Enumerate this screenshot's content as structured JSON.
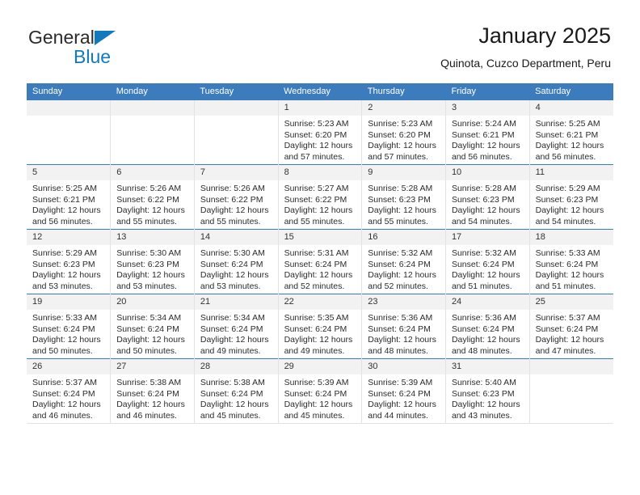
{
  "brand": {
    "name_part1": "General",
    "name_part2": "Blue",
    "accent_color": "#1179c0"
  },
  "header": {
    "title": "January 2025",
    "subtitle": "Quinota, Cuzco Department, Peru"
  },
  "theme": {
    "header_row_bg": "#3c7cbd",
    "daynum_bg": "#f2f2f2",
    "grid_line": "#e3e3e3"
  },
  "weekdays": [
    "Sunday",
    "Monday",
    "Tuesday",
    "Wednesday",
    "Thursday",
    "Friday",
    "Saturday"
  ],
  "weeks": [
    [
      {
        "day": "",
        "sunrise": "",
        "sunset": "",
        "daylight": "",
        "daylight2": "",
        "empty": true
      },
      {
        "day": "",
        "sunrise": "",
        "sunset": "",
        "daylight": "",
        "daylight2": "",
        "empty": true
      },
      {
        "day": "",
        "sunrise": "",
        "sunset": "",
        "daylight": "",
        "daylight2": "",
        "empty": true
      },
      {
        "day": "1",
        "sunrise": "Sunrise: 5:23 AM",
        "sunset": "Sunset: 6:20 PM",
        "daylight": "Daylight: 12 hours",
        "daylight2": "and 57 minutes."
      },
      {
        "day": "2",
        "sunrise": "Sunrise: 5:23 AM",
        "sunset": "Sunset: 6:20 PM",
        "daylight": "Daylight: 12 hours",
        "daylight2": "and 57 minutes."
      },
      {
        "day": "3",
        "sunrise": "Sunrise: 5:24 AM",
        "sunset": "Sunset: 6:21 PM",
        "daylight": "Daylight: 12 hours",
        "daylight2": "and 56 minutes."
      },
      {
        "day": "4",
        "sunrise": "Sunrise: 5:25 AM",
        "sunset": "Sunset: 6:21 PM",
        "daylight": "Daylight: 12 hours",
        "daylight2": "and 56 minutes."
      }
    ],
    [
      {
        "day": "5",
        "sunrise": "Sunrise: 5:25 AM",
        "sunset": "Sunset: 6:21 PM",
        "daylight": "Daylight: 12 hours",
        "daylight2": "and 56 minutes."
      },
      {
        "day": "6",
        "sunrise": "Sunrise: 5:26 AM",
        "sunset": "Sunset: 6:22 PM",
        "daylight": "Daylight: 12 hours",
        "daylight2": "and 55 minutes."
      },
      {
        "day": "7",
        "sunrise": "Sunrise: 5:26 AM",
        "sunset": "Sunset: 6:22 PM",
        "daylight": "Daylight: 12 hours",
        "daylight2": "and 55 minutes."
      },
      {
        "day": "8",
        "sunrise": "Sunrise: 5:27 AM",
        "sunset": "Sunset: 6:22 PM",
        "daylight": "Daylight: 12 hours",
        "daylight2": "and 55 minutes."
      },
      {
        "day": "9",
        "sunrise": "Sunrise: 5:28 AM",
        "sunset": "Sunset: 6:23 PM",
        "daylight": "Daylight: 12 hours",
        "daylight2": "and 55 minutes."
      },
      {
        "day": "10",
        "sunrise": "Sunrise: 5:28 AM",
        "sunset": "Sunset: 6:23 PM",
        "daylight": "Daylight: 12 hours",
        "daylight2": "and 54 minutes."
      },
      {
        "day": "11",
        "sunrise": "Sunrise: 5:29 AM",
        "sunset": "Sunset: 6:23 PM",
        "daylight": "Daylight: 12 hours",
        "daylight2": "and 54 minutes."
      }
    ],
    [
      {
        "day": "12",
        "sunrise": "Sunrise: 5:29 AM",
        "sunset": "Sunset: 6:23 PM",
        "daylight": "Daylight: 12 hours",
        "daylight2": "and 53 minutes."
      },
      {
        "day": "13",
        "sunrise": "Sunrise: 5:30 AM",
        "sunset": "Sunset: 6:23 PM",
        "daylight": "Daylight: 12 hours",
        "daylight2": "and 53 minutes."
      },
      {
        "day": "14",
        "sunrise": "Sunrise: 5:30 AM",
        "sunset": "Sunset: 6:24 PM",
        "daylight": "Daylight: 12 hours",
        "daylight2": "and 53 minutes."
      },
      {
        "day": "15",
        "sunrise": "Sunrise: 5:31 AM",
        "sunset": "Sunset: 6:24 PM",
        "daylight": "Daylight: 12 hours",
        "daylight2": "and 52 minutes."
      },
      {
        "day": "16",
        "sunrise": "Sunrise: 5:32 AM",
        "sunset": "Sunset: 6:24 PM",
        "daylight": "Daylight: 12 hours",
        "daylight2": "and 52 minutes."
      },
      {
        "day": "17",
        "sunrise": "Sunrise: 5:32 AM",
        "sunset": "Sunset: 6:24 PM",
        "daylight": "Daylight: 12 hours",
        "daylight2": "and 51 minutes."
      },
      {
        "day": "18",
        "sunrise": "Sunrise: 5:33 AM",
        "sunset": "Sunset: 6:24 PM",
        "daylight": "Daylight: 12 hours",
        "daylight2": "and 51 minutes."
      }
    ],
    [
      {
        "day": "19",
        "sunrise": "Sunrise: 5:33 AM",
        "sunset": "Sunset: 6:24 PM",
        "daylight": "Daylight: 12 hours",
        "daylight2": "and 50 minutes."
      },
      {
        "day": "20",
        "sunrise": "Sunrise: 5:34 AM",
        "sunset": "Sunset: 6:24 PM",
        "daylight": "Daylight: 12 hours",
        "daylight2": "and 50 minutes."
      },
      {
        "day": "21",
        "sunrise": "Sunrise: 5:34 AM",
        "sunset": "Sunset: 6:24 PM",
        "daylight": "Daylight: 12 hours",
        "daylight2": "and 49 minutes."
      },
      {
        "day": "22",
        "sunrise": "Sunrise: 5:35 AM",
        "sunset": "Sunset: 6:24 PM",
        "daylight": "Daylight: 12 hours",
        "daylight2": "and 49 minutes."
      },
      {
        "day": "23",
        "sunrise": "Sunrise: 5:36 AM",
        "sunset": "Sunset: 6:24 PM",
        "daylight": "Daylight: 12 hours",
        "daylight2": "and 48 minutes."
      },
      {
        "day": "24",
        "sunrise": "Sunrise: 5:36 AM",
        "sunset": "Sunset: 6:24 PM",
        "daylight": "Daylight: 12 hours",
        "daylight2": "and 48 minutes."
      },
      {
        "day": "25",
        "sunrise": "Sunrise: 5:37 AM",
        "sunset": "Sunset: 6:24 PM",
        "daylight": "Daylight: 12 hours",
        "daylight2": "and 47 minutes."
      }
    ],
    [
      {
        "day": "26",
        "sunrise": "Sunrise: 5:37 AM",
        "sunset": "Sunset: 6:24 PM",
        "daylight": "Daylight: 12 hours",
        "daylight2": "and 46 minutes."
      },
      {
        "day": "27",
        "sunrise": "Sunrise: 5:38 AM",
        "sunset": "Sunset: 6:24 PM",
        "daylight": "Daylight: 12 hours",
        "daylight2": "and 46 minutes."
      },
      {
        "day": "28",
        "sunrise": "Sunrise: 5:38 AM",
        "sunset": "Sunset: 6:24 PM",
        "daylight": "Daylight: 12 hours",
        "daylight2": "and 45 minutes."
      },
      {
        "day": "29",
        "sunrise": "Sunrise: 5:39 AM",
        "sunset": "Sunset: 6:24 PM",
        "daylight": "Daylight: 12 hours",
        "daylight2": "and 45 minutes."
      },
      {
        "day": "30",
        "sunrise": "Sunrise: 5:39 AM",
        "sunset": "Sunset: 6:24 PM",
        "daylight": "Daylight: 12 hours",
        "daylight2": "and 44 minutes."
      },
      {
        "day": "31",
        "sunrise": "Sunrise: 5:40 AM",
        "sunset": "Sunset: 6:23 PM",
        "daylight": "Daylight: 12 hours",
        "daylight2": "and 43 minutes."
      },
      {
        "day": "",
        "sunrise": "",
        "sunset": "",
        "daylight": "",
        "daylight2": "",
        "empty": true
      }
    ]
  ]
}
